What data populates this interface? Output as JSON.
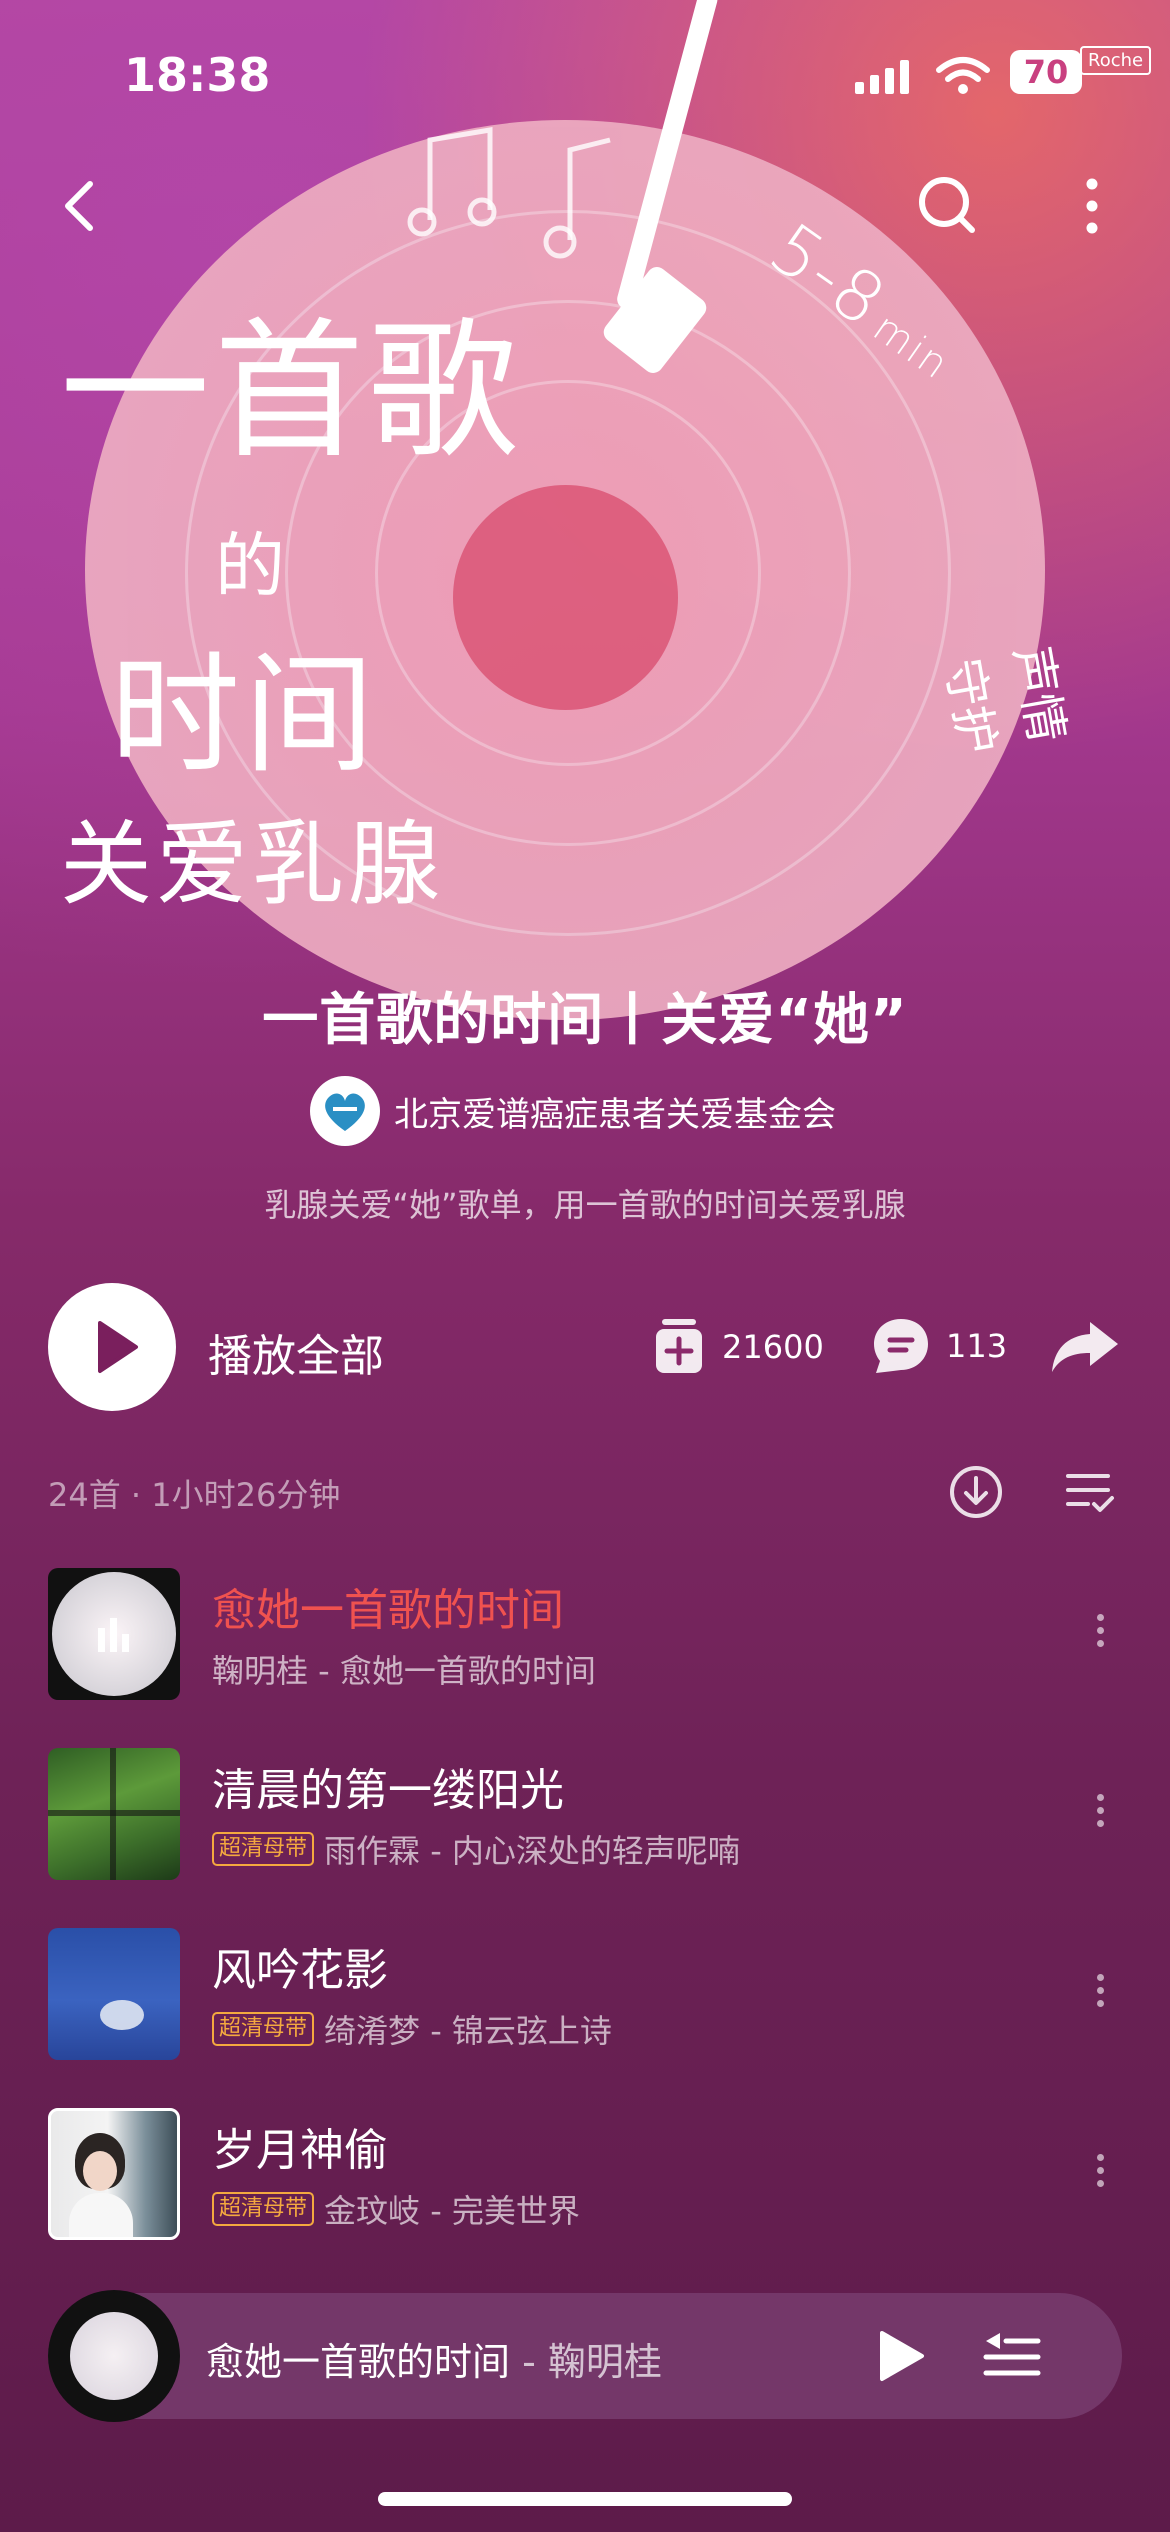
{
  "status": {
    "time": "18:38",
    "battery": "70",
    "carrier_tag": "Roche"
  },
  "cover_art": {
    "calligraphy_line1": "一首歌",
    "calligraphy_line2": "的",
    "calligraphy_line3": "时间",
    "calligraphy_line4": "关爱乳腺",
    "duration_tag": "5-8",
    "duration_unit": "min",
    "side_text": "声情守护"
  },
  "playlist": {
    "title": "一首歌的时间丨关爱“她”",
    "creator": "北京爱谱癌症患者关爱基金会",
    "description": "乳腺关爱“她”歌单，用一首歌的时间关爱乳腺"
  },
  "actions": {
    "play_all": "播放全部",
    "collect_count": "21600",
    "comment_count": "113"
  },
  "meta": {
    "summary": "24首 · 1小时26分钟"
  },
  "songs": [
    {
      "title": "愈她一首歌的时间",
      "subtitle": "鞠明桂 - 愈她一首歌的时间",
      "badge": "",
      "playing": true
    },
    {
      "title": "清晨的第一缕阳光",
      "subtitle": "雨作霖 - 内心深处的轻声呢喃",
      "badge": "超清母带"
    },
    {
      "title": "风吟花影",
      "subtitle": "绮淆梦 - 锦云弦上诗",
      "badge": "超清母带"
    },
    {
      "title": "岁月神偷",
      "subtitle": "金玟岐 - 完美世界",
      "badge": "超清母带"
    }
  ],
  "mini_player": {
    "title": "愈她一首歌的时间",
    "artist": "- 鞠明桂"
  },
  "colors": {
    "playing_title": "#f0524f",
    "badge": "#f4a93f"
  },
  "icons": [
    "back-icon",
    "search-icon",
    "more-vertical-icon",
    "play-icon",
    "collect-icon",
    "comment-icon",
    "share-icon",
    "download-icon",
    "multi-select-icon",
    "playlist-icon"
  ]
}
